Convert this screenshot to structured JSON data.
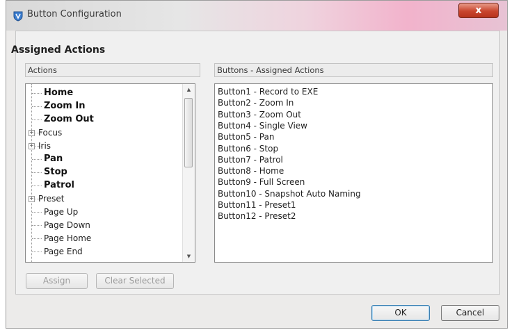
{
  "window": {
    "title": "Button Configuration",
    "close_glyph": "x"
  },
  "group_title": "Assigned Actions",
  "actions": {
    "header": "Actions",
    "items": [
      {
        "label": "Home",
        "bold": true,
        "expandable": false
      },
      {
        "label": "Zoom In",
        "bold": true,
        "expandable": false
      },
      {
        "label": "Zoom Out",
        "bold": true,
        "expandable": false
      },
      {
        "label": "Focus",
        "bold": false,
        "expandable": true
      },
      {
        "label": "Iris",
        "bold": false,
        "expandable": true
      },
      {
        "label": "Pan",
        "bold": true,
        "expandable": false
      },
      {
        "label": "Stop",
        "bold": true,
        "expandable": false
      },
      {
        "label": "Patrol",
        "bold": true,
        "expandable": false
      },
      {
        "label": "Preset",
        "bold": false,
        "expandable": true
      },
      {
        "label": "Page Up",
        "bold": false,
        "expandable": false
      },
      {
        "label": "Page Down",
        "bold": false,
        "expandable": false
      },
      {
        "label": "Page Home",
        "bold": false,
        "expandable": false
      },
      {
        "label": "Page End",
        "bold": false,
        "expandable": false
      }
    ]
  },
  "assigned": {
    "header": "Buttons - Assigned Actions",
    "items": [
      "Button1  - Record to EXE",
      "Button2  - Zoom In",
      "Button3  - Zoom Out",
      "Button4  - Single View",
      "Button5  - Pan",
      "Button6  - Stop",
      "Button7  - Patrol",
      "Button8  - Home",
      "Button9  - Full Screen",
      "Button10 - Snapshot Auto Naming",
      "Button11 - Preset1",
      "Button12 - Preset2"
    ]
  },
  "buttons": {
    "assign": "Assign",
    "clear_selected": "Clear Selected",
    "ok": "OK",
    "cancel": "Cancel"
  },
  "icons": {
    "app": "shield-icon",
    "expander": "plus-box-icon",
    "scroll_up": "arrow-up-icon",
    "scroll_down": "arrow-down-icon"
  },
  "colors": {
    "close_button": "#c9452e",
    "default_button_border": "#3c7fb1"
  }
}
